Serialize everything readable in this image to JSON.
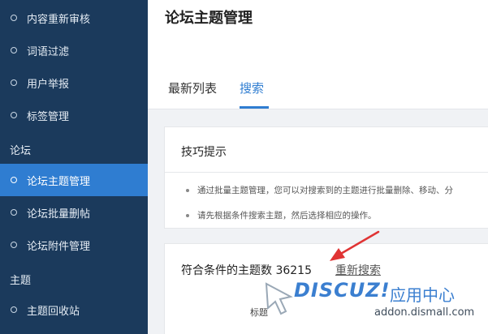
{
  "sidebar": {
    "items": [
      {
        "label": "内容重新审核"
      },
      {
        "label": "词语过滤"
      },
      {
        "label": "用户举报"
      },
      {
        "label": "标签管理"
      },
      {
        "label": "论坛主题管理",
        "active": true
      },
      {
        "label": "论坛批量删帖"
      },
      {
        "label": "论坛附件管理"
      },
      {
        "label": "主题回收站"
      }
    ],
    "groups": [
      "论坛",
      "主题"
    ]
  },
  "header": {
    "title": "论坛主题管理",
    "tabs": [
      "最新列表",
      "搜索"
    ],
    "active_tab": "搜索"
  },
  "tips": {
    "title": "技巧提示",
    "lines": [
      "通过批量主题管理，您可以对搜索到的主题进行批量删除、移动、分",
      "请先根据条件搜索主题，然后选择相应的操作。"
    ]
  },
  "result": {
    "label": "符合条件的主题数 36215",
    "link": "重新搜索",
    "column_title": "标题"
  },
  "watermark": {
    "brand": "DISCUZ!",
    "cn": "应用中心",
    "url": "addon.dismall.com"
  },
  "colors": {
    "sidebar_bg": "#1b3a5c",
    "accent": "#2f7dd1",
    "arrow": "#e03434"
  }
}
